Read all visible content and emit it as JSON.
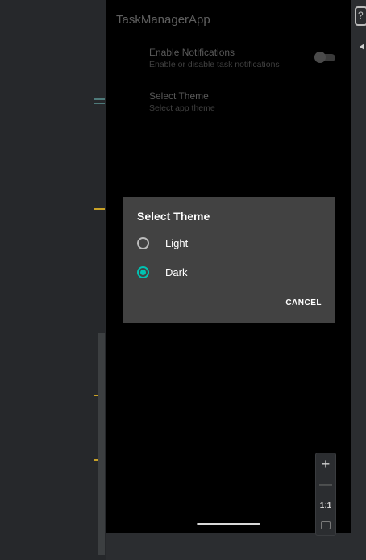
{
  "app": {
    "title": "TaskManagerApp"
  },
  "settings": {
    "notifications": {
      "title": "Enable Notifications",
      "summary": "Enable or disable task notifications",
      "enabled": false
    },
    "theme": {
      "title": "Select Theme",
      "summary": "Select app theme"
    }
  },
  "dialog": {
    "title": "Select Theme",
    "options": [
      {
        "label": "Light",
        "selected": false
      },
      {
        "label": "Dark",
        "selected": true
      }
    ],
    "cancel_label": "CANCEL"
  },
  "zoom": {
    "in_label": "+",
    "out_label": "—",
    "reset_label": "1:1"
  },
  "colors": {
    "accent": "#00c2b2",
    "dialog_bg": "#424242",
    "screen_bg": "#000000"
  }
}
